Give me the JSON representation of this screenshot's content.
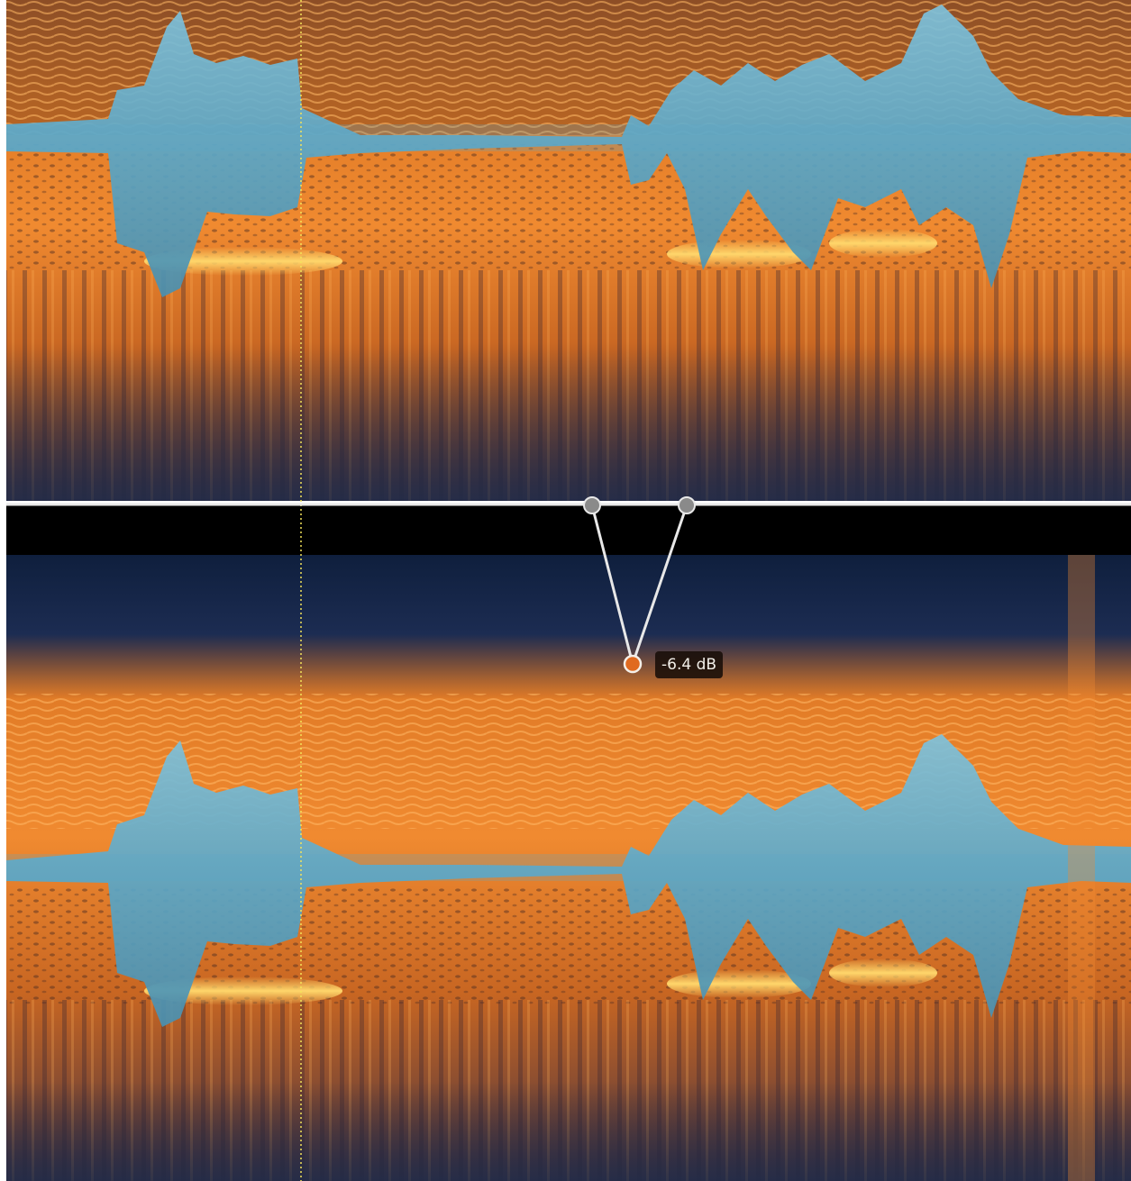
{
  "editor": {
    "gain_readout": "-6.4 dB",
    "icons": {
      "left_node": "envelope-node-icon",
      "right_node": "envelope-node-icon",
      "bottom_node": "active-envelope-node-icon"
    },
    "colors": {
      "spectral_orange": "#e07a26",
      "spectral_bright": "#ffd66b",
      "spectral_blue": "#5aa7c8",
      "deep_navy": "#0f1f3d",
      "channel_divider": "#000000",
      "envelope_line": "#e8e8e8",
      "inactive_node": "#8a8a8a",
      "active_node": "#e06a1f",
      "playhead": "#f3e35a"
    }
  }
}
